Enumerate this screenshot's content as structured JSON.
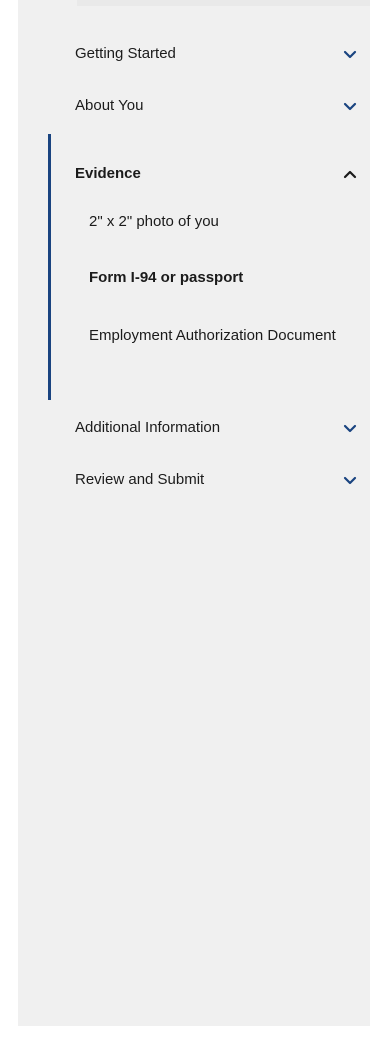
{
  "sidebar": {
    "items": [
      {
        "label": "Getting Started",
        "expanded": false,
        "icon": "chevron-down-icon"
      },
      {
        "label": "About You",
        "expanded": false,
        "icon": "chevron-down-icon"
      },
      {
        "label": "Evidence",
        "expanded": true,
        "active": true,
        "icon": "chevron-up-icon",
        "children": [
          {
            "label": "2\" x 2\" photo of you",
            "current": false
          },
          {
            "label": "Form I-94 or passport",
            "current": true
          },
          {
            "label": "Employment Authorization Document",
            "current": false
          }
        ]
      },
      {
        "label": "Additional Information",
        "expanded": false,
        "icon": "chevron-down-icon"
      },
      {
        "label": "Review and Submit",
        "expanded": false,
        "icon": "chevron-down-icon"
      }
    ]
  },
  "colors": {
    "panel_background": "#f0f0f0",
    "active_indicator": "#1a4480",
    "text": "#1b1b1b",
    "chevron": "#1a4480"
  }
}
